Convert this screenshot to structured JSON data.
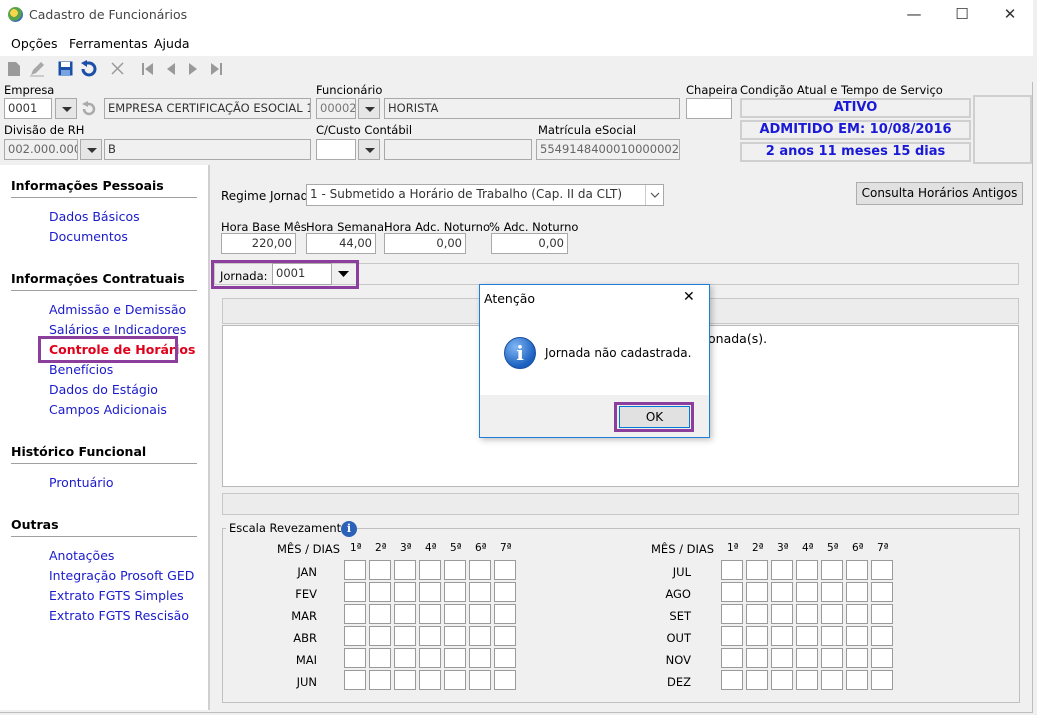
{
  "window": {
    "title": "Cadastro de Funcionários",
    "minimize": "—",
    "maximize": "☐",
    "close": "✕"
  },
  "menu": [
    {
      "label": "Opções"
    },
    {
      "label": "Ferramentas"
    },
    {
      "label": "Ajuda"
    }
  ],
  "header": {
    "empresa_label": "Empresa",
    "empresa_code": "0001",
    "empresa_name": "EMPRESA CERTIFICAÇÃO ESOCIAL 1",
    "funcionario_label": "Funcionário",
    "funcionario_code": "00002",
    "funcionario_name": "HORISTA",
    "chapeira_label": "Chapeira",
    "chapeira_value": "",
    "condicao_label": "Condição Atual e Tempo de Serviço",
    "status": "ATIVO",
    "admitido": "ADMITIDO EM: 10/08/2016",
    "tempo": "2 anos 11 meses 15 dias",
    "divisao_label": "Divisão de RH",
    "divisao_code": "002.000.000",
    "divisao_name": "B",
    "custo_label": "C/Custo Contábil",
    "custo_code": "",
    "custo_name": "",
    "matricula_label": "Matrícula eSocial",
    "matricula_value": "5549148400010000002"
  },
  "sidebar": {
    "sections": [
      {
        "title": "Informações Pessoais",
        "links": [
          "Dados Básicos",
          "Documentos"
        ]
      },
      {
        "title": "Informações Contratuais",
        "links": [
          "Admissão e Demissão",
          "Salários e Indicadores",
          "Controle de Horários",
          "Benefícios",
          "Dados do Estágio",
          "Campos Adicionais"
        ]
      },
      {
        "title": "Histórico Funcional",
        "links": [
          "Prontuário"
        ]
      },
      {
        "title": "Outras",
        "links": [
          "Anotações",
          "Integração Prosoft GED",
          "Extrato FGTS Simples",
          "Extrato FGTS Rescisão"
        ]
      }
    ],
    "active": "Controle de Horários"
  },
  "main": {
    "regime_label": "Regime Jornada",
    "regime_value": "1 - Submetido a Horário de Trabalho (Cap. II da CLT)",
    "consulta_button": "Consulta Horários Antigos",
    "hora_base_label": "Hora Base Mês",
    "hora_base_value": "220,00",
    "hora_semanal_label": "Hora Semanal",
    "hora_semanal_value": "44,00",
    "hora_adc_label": "Hora Adc. Noturno",
    "hora_adc_value": "0,00",
    "pct_adc_label": "% Adc. Noturno",
    "pct_adc_value": "0,00",
    "jornada_label": "Jornada:",
    "jornada_value": "0001",
    "panel_text": "onada(s).",
    "escala_label": "Escala Revezamento",
    "mes_dias_label": "MÊS / DIAS",
    "week_cols": [
      "1ª",
      "2ª",
      "3ª",
      "4ª",
      "5ª",
      "6ª",
      "7ª"
    ],
    "months_left": [
      "JAN",
      "FEV",
      "MAR",
      "ABR",
      "MAI",
      "JUN"
    ],
    "months_right": [
      "JUL",
      "AGO",
      "SET",
      "OUT",
      "NOV",
      "DEZ"
    ]
  },
  "dialog": {
    "title": "Atenção",
    "message": "Jornada não cadastrada.",
    "ok": "OK",
    "close": "✕"
  },
  "colors": {
    "accent_blue": "#1a1ad6",
    "link": "#1a1acd",
    "active_link": "#e0001b",
    "highlight": "#8b3e9c"
  }
}
